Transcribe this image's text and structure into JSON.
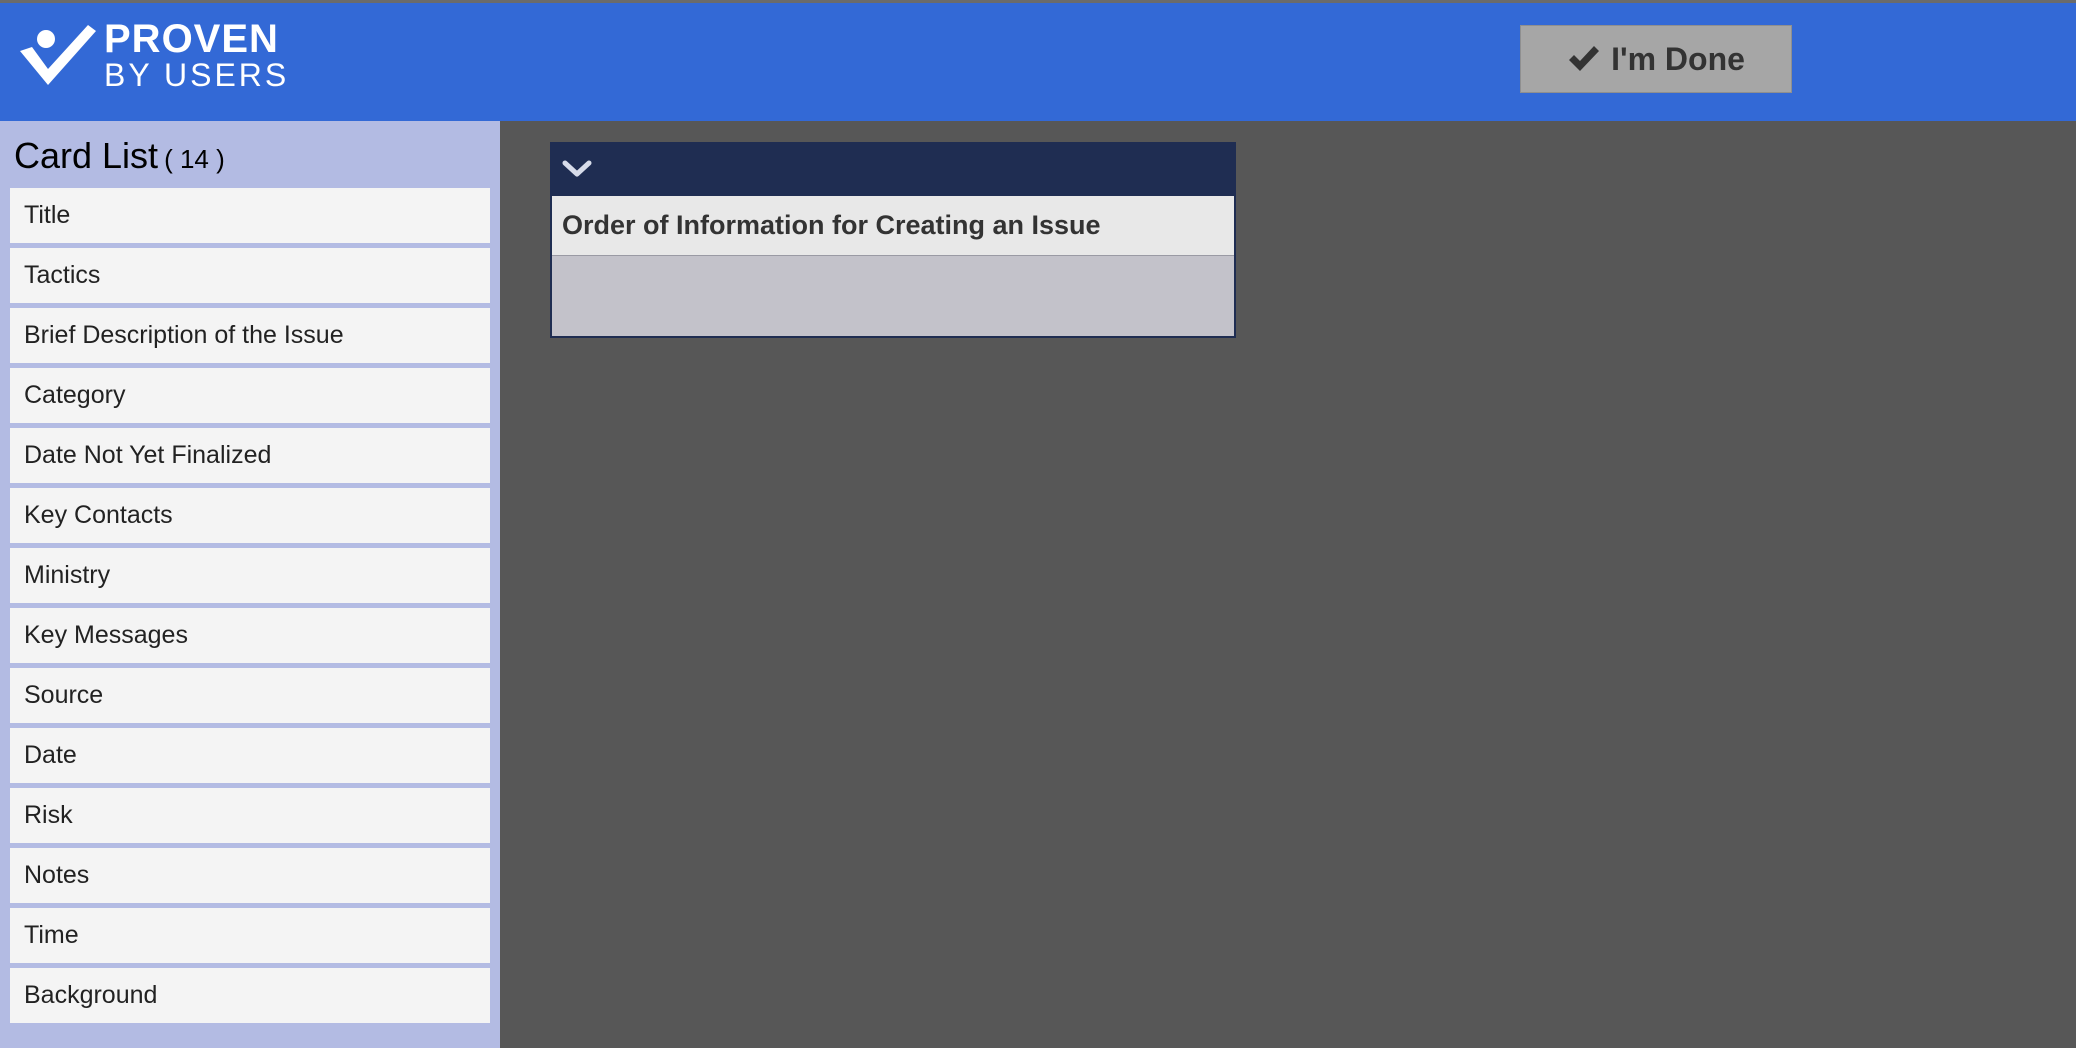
{
  "header": {
    "logo_line1": "PROVEN",
    "logo_line2": "BY USERS",
    "done_label": "I'm Done"
  },
  "sidebar": {
    "title": "Card List",
    "count": "( 14 )",
    "items": [
      {
        "label": "Title"
      },
      {
        "label": "Tactics"
      },
      {
        "label": "Brief Description of the Issue"
      },
      {
        "label": "Category"
      },
      {
        "label": "Date Not Yet Finalized"
      },
      {
        "label": "Key Contacts"
      },
      {
        "label": "Ministry"
      },
      {
        "label": "Key Messages"
      },
      {
        "label": "Source"
      },
      {
        "label": "Date"
      },
      {
        "label": "Risk"
      },
      {
        "label": "Notes"
      },
      {
        "label": "Time"
      },
      {
        "label": "Background"
      }
    ]
  },
  "board": {
    "title": "Order of Information for Creating an Issue"
  },
  "colors": {
    "header_bg": "#3369d6",
    "sidebar_bg": "#b3bbe3",
    "main_bg": "#575757",
    "board_header_bg": "#1f2d52",
    "button_bg": "#a6a6a6"
  },
  "icons": [
    "logo-check-person-icon",
    "checkmark-icon",
    "chevron-down-icon"
  ]
}
